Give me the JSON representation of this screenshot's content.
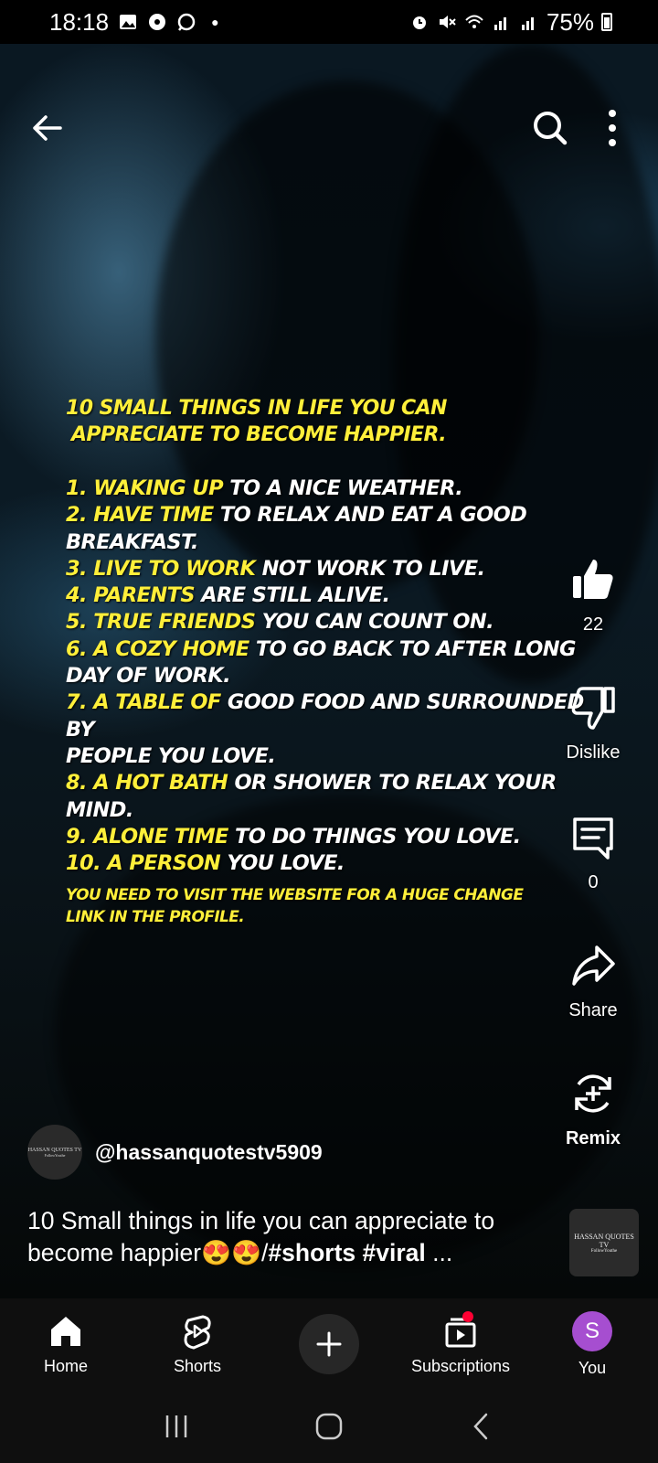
{
  "status_bar": {
    "time": "18:18",
    "battery": "75%"
  },
  "video": {
    "overlay_heading": [
      "10 SMALL THINGS IN LIFE YOU CAN",
      "APPRECIATE TO BECOME HAPPIER."
    ],
    "overlay_items": [
      {
        "hl": "1. WAKING UP",
        "rest": " TO A NICE WEATHER."
      },
      {
        "hl": "2. HAVE TIME",
        "rest": " TO RELAX AND EAT A GOOD"
      },
      {
        "hl": "",
        "rest": "BREAKFAST."
      },
      {
        "hl": "3. LIVE TO WORK",
        "rest": " NOT WORK TO LIVE."
      },
      {
        "hl": "4. PARENTS",
        "rest": " ARE STILL ALIVE."
      },
      {
        "hl": "5. TRUE FRIENDS",
        "rest": " YOU CAN COUNT ON."
      },
      {
        "hl": "6. A COZY HOME",
        "rest": " TO GO BACK TO AFTER LONG"
      },
      {
        "hl": "",
        "rest": " DAY OF WORK."
      },
      {
        "hl": "7. A TABLE OF",
        "rest": " GOOD FOOD AND SURROUNDED BY"
      },
      {
        "hl": "",
        "rest": "PEOPLE YOU LOVE."
      },
      {
        "hl": "8. A HOT BATH",
        "rest": " OR SHOWER TO RELAX YOUR MIND."
      },
      {
        "hl": "9. ALONE TIME",
        "rest": " TO DO THINGS YOU LOVE."
      },
      {
        "hl": "10. A PERSON",
        "rest": " YOU LOVE."
      }
    ],
    "overlay_footer": [
      "YOU NEED TO VISIT THE WEBSITE FOR A HUGE CHANGE",
      "LINK IN THE PROFILE."
    ]
  },
  "actions": {
    "like_count": "22",
    "dislike_label": "Dislike",
    "comment_count": "0",
    "share_label": "Share",
    "remix_label": "Remix"
  },
  "channel": {
    "handle": "@hassanquotestv5909",
    "avatar_text": "HASSAN QUOTES TV",
    "avatar_sub": "FollowYouthe"
  },
  "title": {
    "text": "10 Small things in life you can appreciate to become happier",
    "emoji": "😍😍",
    "slash": "/",
    "tags": "#shorts #viral",
    "ellipsis": " ..."
  },
  "bottom_nav": {
    "home": "Home",
    "shorts": "Shorts",
    "subscriptions": "Subscriptions",
    "you": "You",
    "you_initial": "S"
  },
  "colors": {
    "overlay_yellow": "#ffef3a",
    "you_avatar": "#a64ed0",
    "badge": "#ff0033"
  },
  "icons": [
    "back-arrow-icon",
    "search-icon",
    "more-vert-icon",
    "thumbs-up-icon",
    "thumbs-down-icon",
    "comment-icon",
    "share-icon",
    "remix-icon",
    "home-icon",
    "shorts-icon",
    "plus-icon",
    "subscriptions-icon"
  ]
}
